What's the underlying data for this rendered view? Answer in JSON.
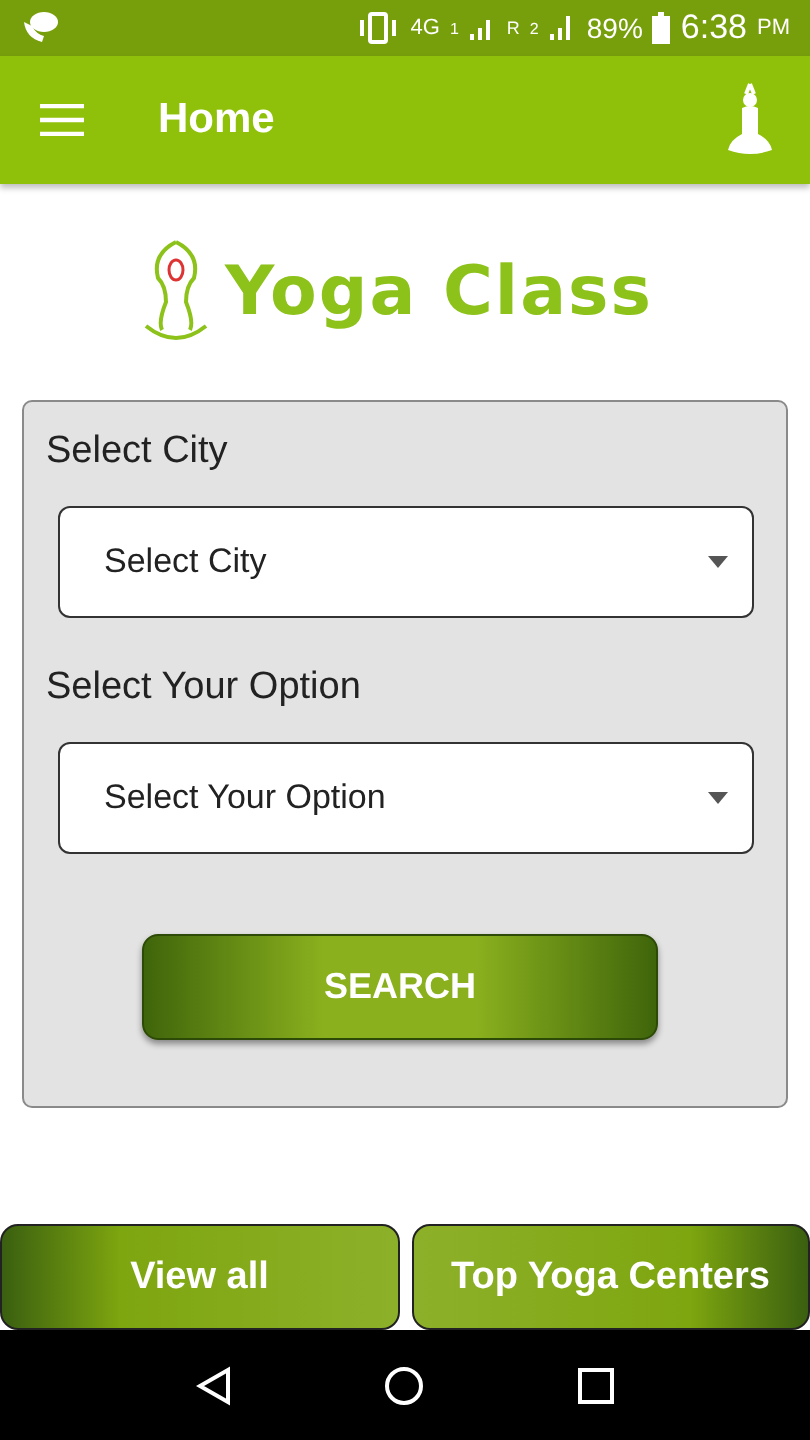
{
  "status_bar": {
    "network": "4G",
    "sim_1": "1",
    "roaming": "R",
    "sim_2": "2",
    "battery": "89%",
    "time": "6:38",
    "meridiem": "PM"
  },
  "app_bar": {
    "title": "Home"
  },
  "logo": {
    "text": "Yoga Class"
  },
  "form": {
    "fields": [
      {
        "label": "Select City",
        "value": "Select City"
      },
      {
        "label": "Select Your Option",
        "value": "Select Your Option"
      }
    ],
    "submit": "SEARCH"
  },
  "bottom_buttons": [
    {
      "label": "View all",
      "kind": "left"
    },
    {
      "label": "Top Yoga Centers",
      "kind": "right"
    }
  ]
}
